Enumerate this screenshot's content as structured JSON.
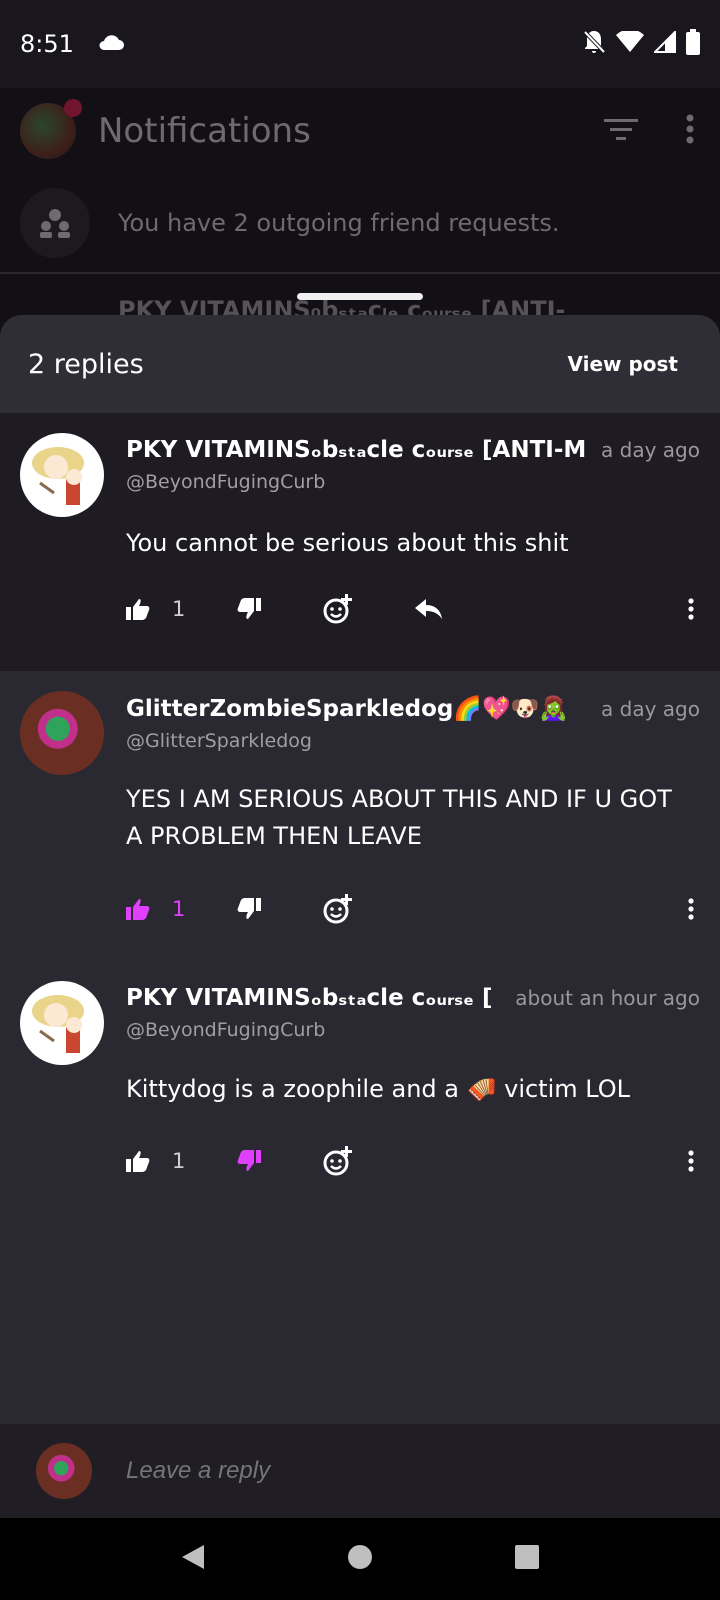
{
  "status": {
    "time": "8:51"
  },
  "app": {
    "title": "Notifications"
  },
  "friend_requests": {
    "text": "You have 2 outgoing friend requests."
  },
  "background_peek": "PKY VITAMINS₀bₛₜₐcₗₑ cₒᵤᵣₛₑ [ANTI-",
  "sheet": {
    "title": "2 replies",
    "view_post": "View post"
  },
  "comments": [
    {
      "name": "PKY VITAMINSₒbₛₜₐcle cₒᵤᵣₛₑ [ANTI-M",
      "time": "a day ago",
      "handle": "@BeyondFugingCurb",
      "text": "You cannot be serious about this shit",
      "likes": "1",
      "liked": false,
      "disliked": false
    },
    {
      "name": "GlitterZombieSparkledog🌈💖🐶🧟‍♀️",
      "time": "a day ago",
      "handle": "@GlitterSparkledog",
      "text": "YES I AM SERIOUS ABOUT THIS AND IF U GOT A PROBLEM THEN LEAVE",
      "likes": "1",
      "liked": true,
      "disliked": false
    },
    {
      "name": "PKY VITAMINSₒbₛₜₐcle cₒᵤᵣₛₑ [",
      "time": "about an hour ago",
      "handle": "@BeyondFugingCurb",
      "text": "Kittydog is a zoophile and a 🪗 victim LOL",
      "likes": "1",
      "liked": false,
      "disliked": true
    }
  ],
  "reply": {
    "placeholder": "Leave a reply"
  },
  "colors": {
    "accent": "#e040fb",
    "sheet": "#2a2830",
    "parent": "#1e1c22"
  },
  "icons": [
    "cloud-icon",
    "bell-off-icon",
    "wifi-icon",
    "signal-icon",
    "battery-icon",
    "filter-icon",
    "more-vert-icon",
    "group-icon",
    "thumb-up-icon",
    "thumb-down-icon",
    "add-reaction-icon",
    "reply-icon",
    "nav-back-icon",
    "nav-home-icon",
    "nav-recents-icon"
  ]
}
